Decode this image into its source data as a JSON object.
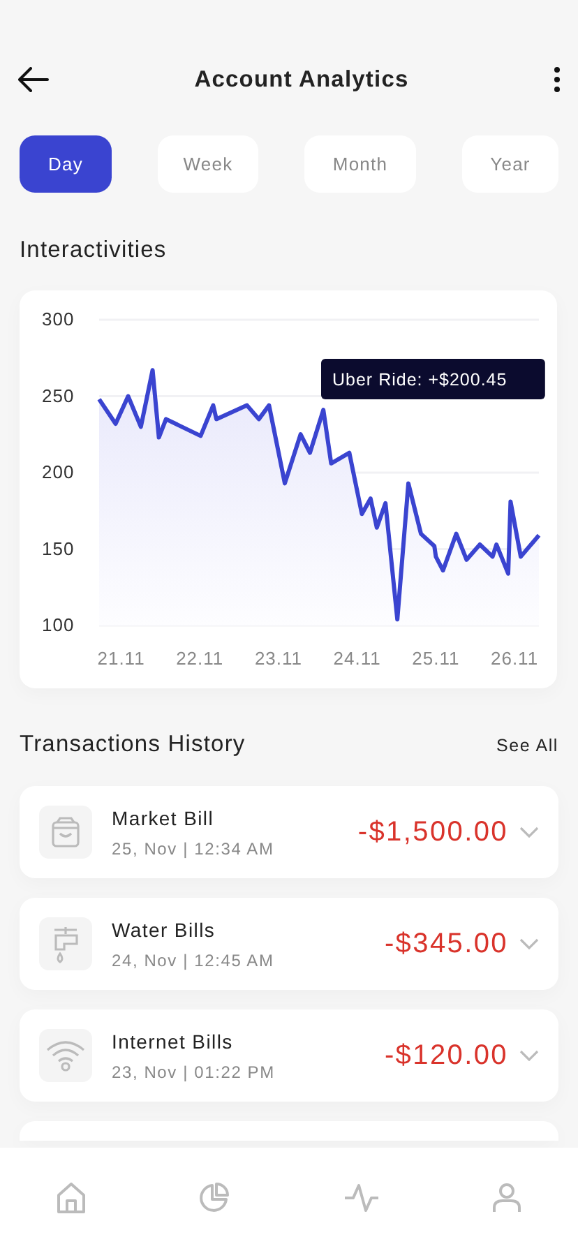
{
  "header": {
    "title": "Account Analytics"
  },
  "tabs": [
    {
      "label": "Day",
      "selected": true
    },
    {
      "label": "Week",
      "selected": false
    },
    {
      "label": "Month",
      "selected": false
    },
    {
      "label": "Year",
      "selected": false
    }
  ],
  "analytics": {
    "title": "Interactivities",
    "chart_data": {
      "type": "area",
      "grid": true,
      "x": [
        20.83,
        21.04,
        21.2,
        21.36,
        21.51,
        21.59,
        21.68,
        22.12,
        22.28,
        22.32,
        22.71,
        22.86,
        22.99,
        23.19,
        23.39,
        23.51,
        23.68,
        23.78,
        24.01,
        24.17,
        24.28,
        24.36,
        24.47,
        24.62,
        24.76,
        24.92,
        25.09,
        25.11,
        25.2,
        25.37,
        25.5,
        25.67,
        25.83,
        25.88,
        26.03,
        26.06,
        26.19,
        26.42
      ],
      "series": [
        {
          "color": "#3a44d0",
          "values": [
            248,
            232,
            250,
            230,
            267,
            223,
            235,
            224,
            244,
            235,
            244,
            235,
            244,
            193,
            225,
            213,
            241,
            206,
            213,
            173,
            183,
            164,
            180,
            104,
            193,
            160,
            152,
            145,
            136,
            160,
            143,
            153,
            145,
            153,
            134,
            181,
            145,
            159
          ]
        }
      ],
      "xlim": [
        20.83,
        26.42
      ],
      "ylim": [
        100,
        300
      ],
      "xticks": [
        21.11,
        22.11,
        23.11,
        24.11,
        25.11,
        26.11
      ],
      "yticks": [
        100,
        150,
        200,
        250,
        300
      ],
      "annotations": [
        "Uber Ride: +$200.45"
      ]
    }
  },
  "transactions": {
    "title": "Transactions History",
    "see_all": "See All",
    "items": [
      {
        "kind": "bag",
        "name": "Market Bill",
        "date": "25, Nov | 12:34 AM",
        "amount": "-$1,500.00"
      },
      {
        "kind": "faucet",
        "name": "Water Bills",
        "date": "24, Nov | 12:45 AM",
        "amount": "-$345.00"
      },
      {
        "kind": "wifi",
        "name": "Internet Bills",
        "date": "23, Nov | 01:22 PM",
        "amount": "-$120.00"
      }
    ]
  }
}
